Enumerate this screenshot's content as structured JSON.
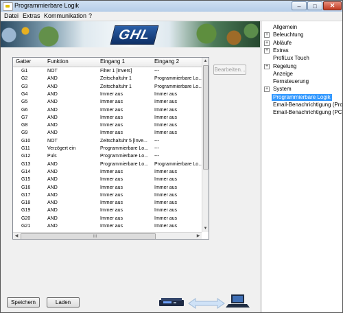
{
  "window": {
    "title": "Programmierbare Logik",
    "minimize_glyph": "‒",
    "maximize_glyph": "□",
    "close_glyph": "✕"
  },
  "menu": {
    "items": [
      "Datei",
      "Extras",
      "Kommunikation",
      "?"
    ]
  },
  "banner": {
    "logo": "GHL"
  },
  "grid": {
    "columns": [
      "Gatter",
      "Funktion",
      "Eingang 1",
      "Eingang 2"
    ],
    "rows": [
      [
        "G1",
        "NOT",
        "Filter 1 [Invers]",
        "---"
      ],
      [
        "G2",
        "AND",
        "Zeitschaltuhr 1",
        "Programmierbare Lo..."
      ],
      [
        "G3",
        "AND",
        "Zeitschaltuhr 1",
        "Programmierbare Lo..."
      ],
      [
        "G4",
        "AND",
        "Immer aus",
        "Immer aus"
      ],
      [
        "G5",
        "AND",
        "Immer aus",
        "Immer aus"
      ],
      [
        "G6",
        "AND",
        "Immer aus",
        "Immer aus"
      ],
      [
        "G7",
        "AND",
        "Immer aus",
        "Immer aus"
      ],
      [
        "G8",
        "AND",
        "Immer aus",
        "Immer aus"
      ],
      [
        "G9",
        "AND",
        "Immer aus",
        "Immer aus"
      ],
      [
        "G10",
        "NOT",
        "Zeitschaltuhr 5 [Inve...",
        "---"
      ],
      [
        "G11",
        "Verzögert ein",
        "Programmierbare Lo...",
        "---"
      ],
      [
        "G12",
        "Puls",
        "Programmierbare Lo...",
        "---"
      ],
      [
        "G13",
        "AND",
        "Programmierbare Lo...",
        "Programmierbare Lo..."
      ],
      [
        "G14",
        "AND",
        "Immer aus",
        "Immer aus"
      ],
      [
        "G15",
        "AND",
        "Immer aus",
        "Immer aus"
      ],
      [
        "G16",
        "AND",
        "Immer aus",
        "Immer aus"
      ],
      [
        "G17",
        "AND",
        "Immer aus",
        "Immer aus"
      ],
      [
        "G18",
        "AND",
        "Immer aus",
        "Immer aus"
      ],
      [
        "G19",
        "AND",
        "Immer aus",
        "Immer aus"
      ],
      [
        "G20",
        "AND",
        "Immer aus",
        "Immer aus"
      ],
      [
        "G21",
        "AND",
        "Immer aus",
        "Immer aus"
      ]
    ],
    "scroll_grip": "III"
  },
  "buttons": {
    "edit": "Bearbeiten...",
    "save": "Speichern",
    "load": "Laden"
  },
  "tree": {
    "items": [
      {
        "label": "Allgemein",
        "expandable": false
      },
      {
        "label": "Beleuchtung",
        "expandable": true
      },
      {
        "label": "Abläufe",
        "expandable": true
      },
      {
        "label": "Extras",
        "expandable": true
      },
      {
        "label": "ProfiLux Touch",
        "expandable": false
      },
      {
        "label": "Regelung",
        "expandable": true
      },
      {
        "label": "Anzeige",
        "expandable": false
      },
      {
        "label": "Fernsteuerung",
        "expandable": false
      },
      {
        "label": "System",
        "expandable": true
      },
      {
        "label": "Programmierbare Logik",
        "expandable": false,
        "selected": true
      },
      {
        "label": "Email-Benachrichtigung (Profil",
        "expandable": false
      },
      {
        "label": "Email-Benachrichtigung (PC)",
        "expandable": false
      }
    ]
  },
  "colors": {
    "selection": "#3399ff",
    "logo_blue": "#1d4f9c",
    "device": "#1e2a44"
  },
  "icons": {
    "device": "profilux-device-icon",
    "arrow": "transfer-arrow-icon",
    "pc": "laptop-icon"
  }
}
